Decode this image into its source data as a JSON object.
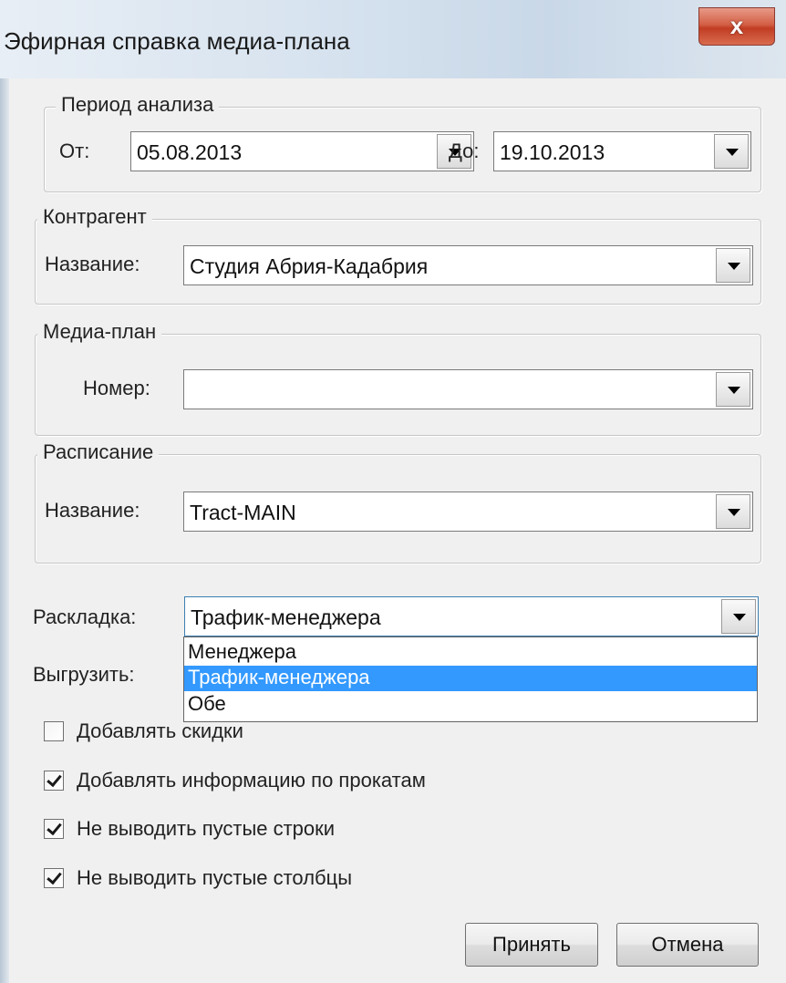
{
  "window": {
    "title": "Эфирная справка медиа-плана",
    "close_glyph": "x"
  },
  "period": {
    "legend": "Период анализа",
    "from_label": "От:",
    "from_value": "05.08.2013",
    "to_label": "До:",
    "to_value": "19.10.2013"
  },
  "counterparty": {
    "legend": "Контрагент",
    "name_label": "Название:",
    "name_value": "Студия Абрия-Кадабрия"
  },
  "media_plan": {
    "legend": "Медиа-план",
    "number_label": "Номер:",
    "number_value": ""
  },
  "schedule": {
    "legend": "Расписание",
    "name_label": "Название:",
    "name_value": "Tract-MAIN"
  },
  "layout": {
    "label": "Раскладка:",
    "selected": "Трафик-менеджера",
    "options": [
      "Менеджера",
      "Трафик-менеджера",
      "Обе"
    ],
    "highlighted_index": 1
  },
  "export": {
    "label": "Выгрузить:"
  },
  "options": [
    {
      "label": "Добавлять скидки",
      "checked": false
    },
    {
      "label": "Добавлять информацию по прокатам",
      "checked": true
    },
    {
      "label": "Не выводить пустые строки",
      "checked": true
    },
    {
      "label": "Не выводить  пустые столбцы",
      "checked": true
    }
  ],
  "buttons": {
    "accept": "Принять",
    "cancel": "Отмена"
  }
}
